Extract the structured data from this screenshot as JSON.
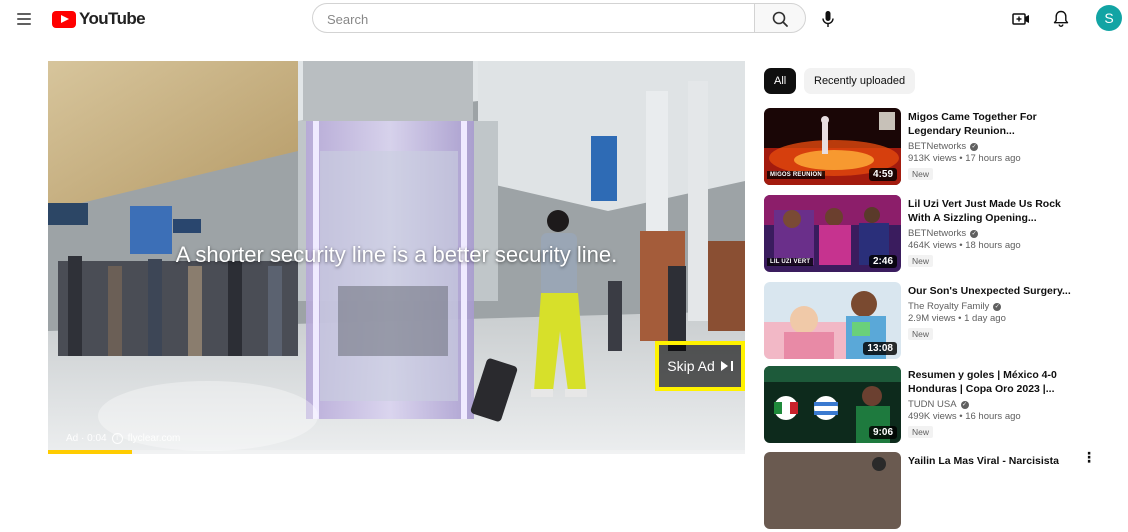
{
  "header": {
    "logo_text": "YouTube",
    "search_placeholder": "Search",
    "avatar_initial": "S"
  },
  "filters": {
    "chips": [
      "All",
      "Recently uploaded"
    ],
    "selected": "All"
  },
  "player": {
    "ad_caption": "A shorter security line is a better security line.",
    "skip_label": "Skip Ad",
    "ad_label": "Ad · 0:04",
    "ad_sponsor": "flyclear.com",
    "ad_progress": 0.12,
    "skip_highlight_color": "#fff200"
  },
  "recommendations": [
    {
      "title": "Migos Came Together For Legendary Reunion...",
      "channel": "BETNetworks",
      "verified": true,
      "views": "913K views",
      "age": "17 hours ago",
      "badge": "New",
      "duration": "4:59",
      "thumb_label": "MIGOS REUNION"
    },
    {
      "title": "Lil Uzi Vert Just Made Us Rock With A Sizzling Opening...",
      "channel": "BETNetworks",
      "verified": true,
      "views": "464K views",
      "age": "18 hours ago",
      "badge": "New",
      "duration": "2:46",
      "thumb_label": "LIL UZI VERT"
    },
    {
      "title": "Our Son's Unexpected Surgery...",
      "channel": "The Royalty Family",
      "verified": true,
      "views": "2.9M views",
      "age": "1 day ago",
      "badge": "New",
      "duration": "13:08",
      "thumb_label": ""
    },
    {
      "title": "Resumen y goles | México 4-0 Honduras | Copa Oro 2023 |...",
      "channel": "TUDN USA",
      "verified": true,
      "views": "499K views",
      "age": "16 hours ago",
      "badge": "New",
      "duration": "9:06",
      "thumb_label": ""
    },
    {
      "title": "Yailin La Mas Viral - Narcisista",
      "channel": "",
      "verified": false,
      "views": "",
      "age": "",
      "badge": "",
      "duration": "",
      "thumb_label": ""
    }
  ]
}
